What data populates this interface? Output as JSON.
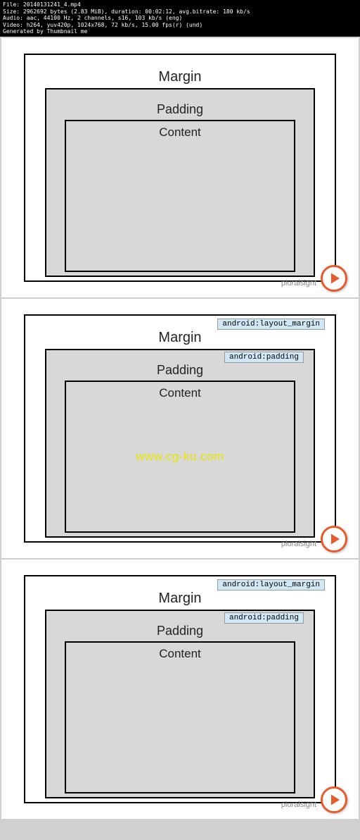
{
  "fileInfo": {
    "line1": "File: 20140131241_4.mp4",
    "line2": "Size: 2962692 bytes (2.83 MiB), duration: 00:02:12, avg.bitrate: 180 kb/s",
    "line3": "Audio: aac, 44100 Hz, 2 channels, s16, 103 kb/s (eng)",
    "line4": "Video: h264, yuv420p, 1024x768, 72 kb/s, 15.00 fps(r) (und)",
    "line5": "Generated by Thumbnail me"
  },
  "labels": {
    "margin": "Margin",
    "padding": "Padding",
    "content": "Content"
  },
  "codes": {
    "margin": "android:layout_margin",
    "padding": "android:padding"
  },
  "watermark": "www.cg-ku.com",
  "brand": "pluralsight",
  "slides": [
    {
      "showCodes": false,
      "showWatermark": false
    },
    {
      "showCodes": true,
      "showWatermark": true
    },
    {
      "showCodes": true,
      "showWatermark": false
    }
  ]
}
